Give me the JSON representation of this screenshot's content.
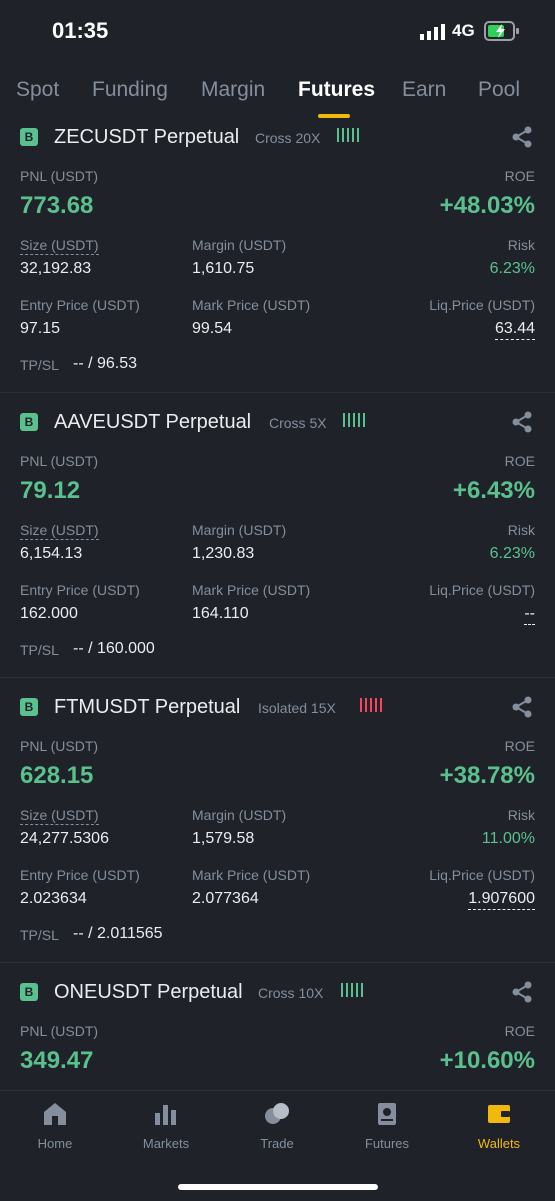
{
  "status": {
    "time": "01:35",
    "network": "4G"
  },
  "tabs": [
    {
      "label": "Spot"
    },
    {
      "label": "Funding"
    },
    {
      "label": "Margin"
    },
    {
      "label": "Futures"
    },
    {
      "label": "Earn"
    },
    {
      "label": "Pool"
    }
  ],
  "active_tab": "Futures",
  "labels": {
    "pnl": "PNL (USDT)",
    "roe": "ROE",
    "size": "Size (USDT)",
    "margin": "Margin (USDT)",
    "risk": "Risk",
    "entry": "Entry Price (USDT)",
    "mark": "Mark Price (USDT)",
    "liq": "Liq.Price (USDT)",
    "tpsl": "TP/SL"
  },
  "positions": [
    {
      "badge": "B",
      "symbol": "ZECUSDT Perpetual",
      "leverage": "Cross 20X",
      "bar_color": "#5ac18e",
      "pnl": "773.68",
      "roe": "+48.03%",
      "size": "32,192.83",
      "margin": "1,610.75",
      "risk": "6.23%",
      "entry": "97.15",
      "mark": "99.54",
      "liq": "63.44",
      "tpsl": "-- / 96.53"
    },
    {
      "badge": "B",
      "symbol": "AAVEUSDT Perpetual",
      "leverage": "Cross 5X",
      "bar_color": "#5ac18e",
      "pnl": "79.12",
      "roe": "+6.43%",
      "size": "6,154.13",
      "margin": "1,230.83",
      "risk": "6.23%",
      "entry": "162.000",
      "mark": "164.110",
      "liq": "--",
      "tpsl": "-- / 160.000"
    },
    {
      "badge": "B",
      "symbol": "FTMUSDT Perpetual",
      "leverage": "Isolated 15X",
      "bar_color": "#f6465d",
      "pnl": "628.15",
      "roe": "+38.78%",
      "size": "24,277.5306",
      "margin": "1,579.58",
      "risk": "11.00%",
      "entry": "2.023634",
      "mark": "2.077364",
      "liq": "1.907600",
      "tpsl": "-- / 2.011565"
    },
    {
      "badge": "B",
      "symbol": "ONEUSDT Perpetual",
      "leverage": "Cross 10X",
      "bar_color": "#5ac18e",
      "pnl": "349.47",
      "roe": "+10.60%"
    }
  ],
  "nav": [
    {
      "label": "Home",
      "icon": "home-icon"
    },
    {
      "label": "Markets",
      "icon": "markets-icon"
    },
    {
      "label": "Trade",
      "icon": "trade-icon"
    },
    {
      "label": "Futures",
      "icon": "futures-icon"
    },
    {
      "label": "Wallets",
      "icon": "wallets-icon"
    }
  ],
  "colors": {
    "accent": "#f0b90b",
    "positive": "#5ac18e",
    "negative": "#f6465d",
    "background": "#1f2329"
  }
}
